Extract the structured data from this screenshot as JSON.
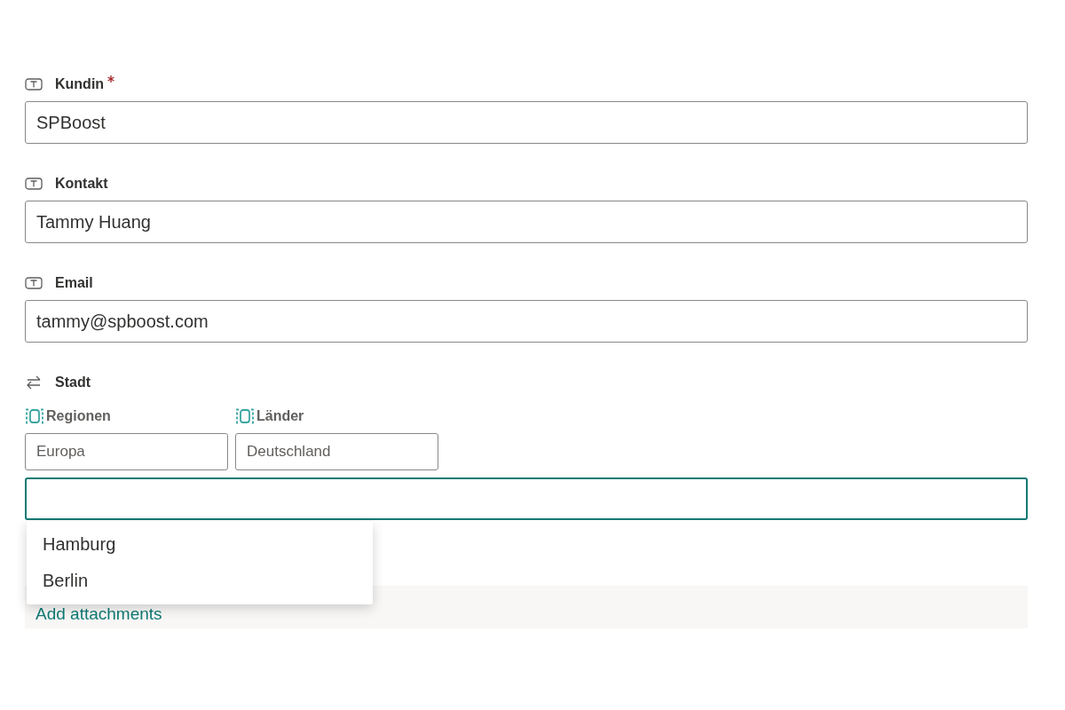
{
  "fields": [
    {
      "kind": "text",
      "label": "Kundin",
      "required": true,
      "value": "SPBoost"
    },
    {
      "kind": "text",
      "label": "Kontakt",
      "required": false,
      "value": "Tammy Huang"
    },
    {
      "kind": "text",
      "label": "Email",
      "required": false,
      "value": "tammy@spboost.com"
    }
  ],
  "lookup": {
    "label": "Stadt",
    "filters": [
      {
        "label": "Regionen",
        "value": "Europa"
      },
      {
        "label": "Länder",
        "value": "Deutschland"
      }
    ],
    "focused": true,
    "options": [
      {
        "label": "Hamburg"
      },
      {
        "label": "Berlin"
      }
    ]
  },
  "attachments": {
    "link": "Add attachments"
  }
}
